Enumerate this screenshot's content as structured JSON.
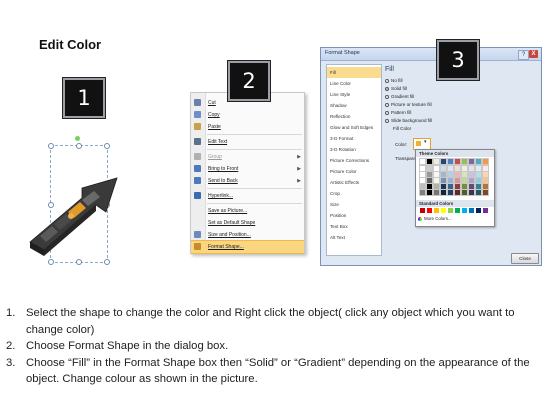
{
  "slide": {
    "title": "Edit Color"
  },
  "steps": {
    "step1": "1",
    "step2": "2",
    "step3": "3"
  },
  "context_menu": {
    "items": [
      {
        "label": "Cut",
        "icon": "scissors-icon",
        "color": "#6a7fb0",
        "disabled": false,
        "submenu": false
      },
      {
        "label": "Copy",
        "icon": "copy-icon",
        "color": "#6c8fc8",
        "disabled": false,
        "submenu": false
      },
      {
        "label": "Paste",
        "icon": "paste-icon",
        "color": "#c9a14a",
        "disabled": false,
        "submenu": false
      },
      {
        "label": "Edit Text",
        "icon": "edit-text-icon",
        "color": "#5b6f8f",
        "disabled": false,
        "submenu": false
      },
      {
        "label": "Group",
        "icon": "group-icon",
        "color": "#b0b0b0",
        "disabled": true,
        "submenu": true
      },
      {
        "label": "Bring to Front",
        "icon": "bring-to-front-icon",
        "color": "#4d79c2",
        "disabled": false,
        "submenu": true
      },
      {
        "label": "Send to Back",
        "icon": "send-to-back-icon",
        "color": "#4d79c2",
        "disabled": false,
        "submenu": true
      },
      {
        "label": "Hyperlink...",
        "icon": "hyperlink-icon",
        "color": "#3a6bb5",
        "disabled": false,
        "submenu": false
      },
      {
        "label": "Save as Picture...",
        "icon": "",
        "color": "",
        "disabled": false,
        "submenu": false
      },
      {
        "label": "Set as Default Shape",
        "icon": "",
        "color": "",
        "disabled": false,
        "submenu": false
      },
      {
        "label": "Size and Position...",
        "icon": "size-position-icon",
        "color": "#6b8bbd",
        "disabled": false,
        "submenu": false
      },
      {
        "label": "Format Shape...",
        "icon": "format-shape-icon",
        "color": "#c98a2a",
        "disabled": false,
        "submenu": false,
        "highlighted": true
      }
    ]
  },
  "format_dialog": {
    "title": "Format Shape",
    "help": "?",
    "close_x": "X",
    "left_nav": [
      "Fill",
      "Line Color",
      "Line Style",
      "Shadow",
      "Reflection",
      "Glow and Soft Edges",
      "3-D Format",
      "3-D Rotation",
      "Picture Corrections",
      "Picture Color",
      "Artistic Effects",
      "Crop",
      "Size",
      "Position",
      "Text Box",
      "Alt Text"
    ],
    "fill_heading": "Fill",
    "fill_options": [
      "No fill",
      "Solid fill",
      "Gradient fill",
      "Picture or texture fill",
      "Pattern fill",
      "Slide background fill"
    ],
    "fill_color_label": "Fill Color",
    "color_label": "Color:",
    "transparency_label": "Transparency:",
    "theme_colors_label": "Theme Colors",
    "standard_colors_label": "Standard Colors",
    "more_colors_label": "More Colors...",
    "close_button": "Close",
    "theme_top_row": [
      "#ffffff",
      "#000000",
      "#eeece1",
      "#1f497d",
      "#4f81bd",
      "#c0504d",
      "#9bbb59",
      "#8064a2",
      "#4bacc6",
      "#f79646"
    ],
    "standard_colors": [
      "#c00000",
      "#ff0000",
      "#ffc000",
      "#ffff00",
      "#92d050",
      "#00b050",
      "#00b0f0",
      "#0070c0",
      "#002060",
      "#7030a0"
    ]
  },
  "instructions": [
    {
      "num": "1.",
      "text": "Select the shape to change the color and Right click the object( click any object which you want to change color)"
    },
    {
      "num": "2.",
      "text": "Choose Format Shape in the dialog box."
    },
    {
      "num": "3.",
      "text": "Choose “Fill” in the Format Shape box then “Solid” or “Gradient” depending on the appearance of the object. Change colour as shown in the picture."
    }
  ]
}
